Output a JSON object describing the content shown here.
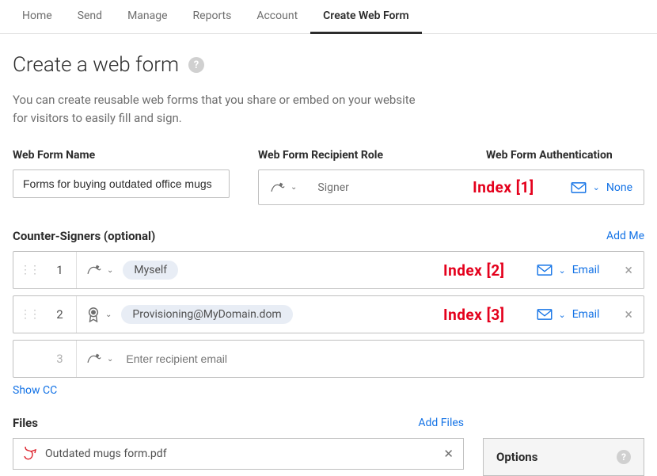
{
  "tabs": [
    "Home",
    "Send",
    "Manage",
    "Reports",
    "Account",
    "Create Web Form"
  ],
  "activeTabIndex": 5,
  "page": {
    "title": "Create a web form",
    "description": "You can create reusable web forms that you share or embed on your website for visitors to easily fill and sign."
  },
  "labels": {
    "webFormName": "Web Form Name",
    "recipientRole": "Web Form Recipient Role",
    "authentication": "Web Form Authentication",
    "counterSigners": "Counter-Signers (optional)",
    "addMe": "Add Me",
    "showCc": "Show CC",
    "files": "Files",
    "addFiles": "Add Files",
    "options": "Options"
  },
  "form": {
    "nameValue": "Forms for buying outdated office mugs",
    "signerRole": "Signer",
    "authNone": "None",
    "indexAnnot1": "Index [1]"
  },
  "counterSigners": [
    {
      "num": "1",
      "chip": "Myself",
      "index": "Index [2]",
      "auth": "Email",
      "roleIcon": "pen"
    },
    {
      "num": "2",
      "chip": "Provisioning@MyDomain.dom",
      "index": "Index [3]",
      "auth": "Email",
      "roleIcon": "seal"
    }
  ],
  "newRow": {
    "num": "3",
    "placeholder": "Enter recipient email"
  },
  "file": {
    "name": "Outdated mugs form.pdf"
  }
}
